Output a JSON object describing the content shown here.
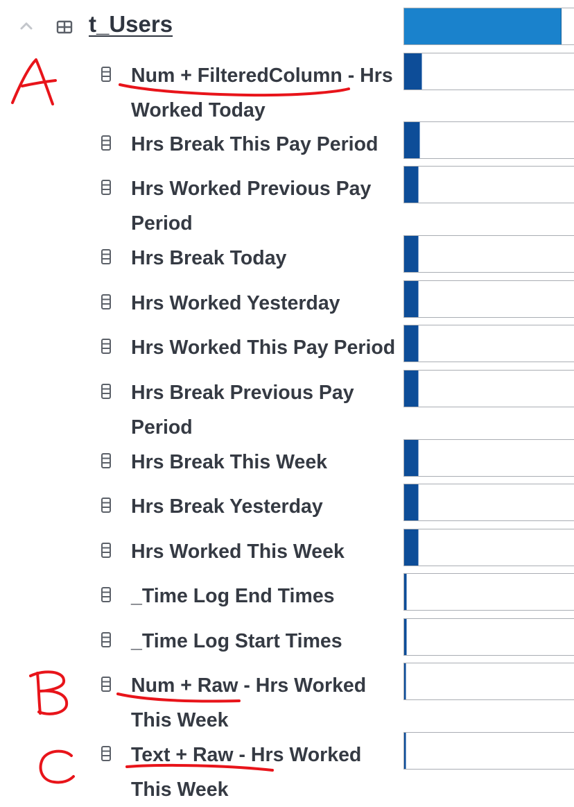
{
  "table": {
    "name": "t_Users",
    "usage_fraction": 0.92
  },
  "columns": [
    {
      "label": "Num + FilteredColumn - Hrs Worked Today",
      "usage_fraction": 0.1
    },
    {
      "label": "Hrs Break This Pay Period",
      "usage_fraction": 0.09
    },
    {
      "label": "Hrs Worked Previous Pay Period",
      "usage_fraction": 0.08
    },
    {
      "label": "Hrs Break Today",
      "usage_fraction": 0.08
    },
    {
      "label": "Hrs Worked Yesterday",
      "usage_fraction": 0.08
    },
    {
      "label": "Hrs Worked This Pay Period",
      "usage_fraction": 0.08
    },
    {
      "label": "Hrs Break Previous Pay Period",
      "usage_fraction": 0.08
    },
    {
      "label": "Hrs Break This Week",
      "usage_fraction": 0.08
    },
    {
      "label": "Hrs Break Yesterday",
      "usage_fraction": 0.08
    },
    {
      "label": "Hrs Worked This Week",
      "usage_fraction": 0.08
    },
    {
      "label": "_Time Log End Times",
      "usage_fraction": 0.012
    },
    {
      "label": "_Time Log Start Times",
      "usage_fraction": 0.012
    },
    {
      "label": "Num + Raw - Hrs Worked This Week",
      "usage_fraction": 0.006
    },
    {
      "label": "Text + Raw - Hrs Worked This Week",
      "usage_fraction": 0.004
    }
  ],
  "annotations": [
    {
      "letter": "A",
      "color": "#e8141a"
    },
    {
      "letter": "B",
      "color": "#e8141a"
    },
    {
      "letter": "C",
      "color": "#e8141a"
    }
  ],
  "icons": {
    "collapse": "chevron-up-icon",
    "table": "table-icon",
    "column": "column-icon"
  }
}
